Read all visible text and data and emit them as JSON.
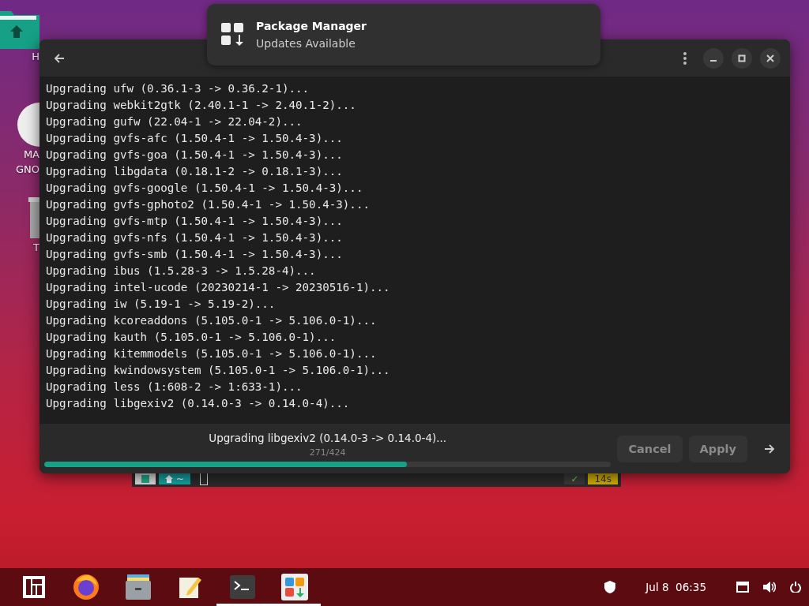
{
  "desktop_icons": [
    {
      "kind": "folder",
      "lines": [
        "H"
      ]
    },
    {
      "kind": "disc",
      "lines": [
        "MA",
        "GNO"
      ]
    },
    {
      "kind": "trash",
      "lines": [
        "T"
      ]
    }
  ],
  "background_terminal": {
    "prompt_path": "~",
    "status_mark": "✓",
    "duration": "14s"
  },
  "window": {
    "log_lines": [
      "Upgrading ufw (0.36.1-3 -> 0.36.2-1)...",
      "Upgrading webkit2gtk (2.40.1-1 -> 2.40.1-2)...",
      "Upgrading gufw (22.04-1 -> 22.04-2)...",
      "Upgrading gvfs-afc (1.50.4-1 -> 1.50.4-3)...",
      "Upgrading gvfs-goa (1.50.4-1 -> 1.50.4-3)...",
      "Upgrading libgdata (0.18.1-2 -> 0.18.1-3)...",
      "Upgrading gvfs-google (1.50.4-1 -> 1.50.4-3)...",
      "Upgrading gvfs-gphoto2 (1.50.4-1 -> 1.50.4-3)...",
      "Upgrading gvfs-mtp (1.50.4-1 -> 1.50.4-3)...",
      "Upgrading gvfs-nfs (1.50.4-1 -> 1.50.4-3)...",
      "Upgrading gvfs-smb (1.50.4-1 -> 1.50.4-3)...",
      "Upgrading ibus (1.5.28-3 -> 1.5.28-4)...",
      "Upgrading intel-ucode (20230214-1 -> 20230516-1)...",
      "Upgrading iw (5.19-1 -> 5.19-2)...",
      "Upgrading kcoreaddons (5.105.0-1 -> 5.106.0-1)...",
      "Upgrading kauth (5.105.0-1 -> 5.106.0-1)...",
      "Upgrading kitemmodels (5.105.0-1 -> 5.106.0-1)...",
      "Upgrading kwindowsystem (5.105.0-1 -> 5.106.0-1)...",
      "Upgrading less (1:608-2 -> 1:633-1)...",
      "Upgrading libgexiv2 (0.14.0-3 -> 0.14.0-4)..."
    ],
    "status": "Upgrading libgexiv2 (0.14.0-3 -> 0.14.0-4)...",
    "counter": "271/424",
    "progress": {
      "level": 0.64
    },
    "buttons": [
      {
        "label": "Cancel",
        "disabled": true
      },
      {
        "label": "Apply",
        "disabled": true
      }
    ]
  },
  "notification": {
    "title": "Package Manager",
    "body": "Updates Available"
  },
  "taskbar": {
    "apps": [
      {
        "kind": "menu",
        "active": false
      },
      {
        "kind": "browser",
        "active": false
      },
      {
        "kind": "files",
        "active": false
      },
      {
        "kind": "editor",
        "active": false
      },
      {
        "kind": "terminal",
        "active": true
      },
      {
        "kind": "packages",
        "active": true
      }
    ],
    "date": "Jul 8",
    "time": "06:35"
  }
}
